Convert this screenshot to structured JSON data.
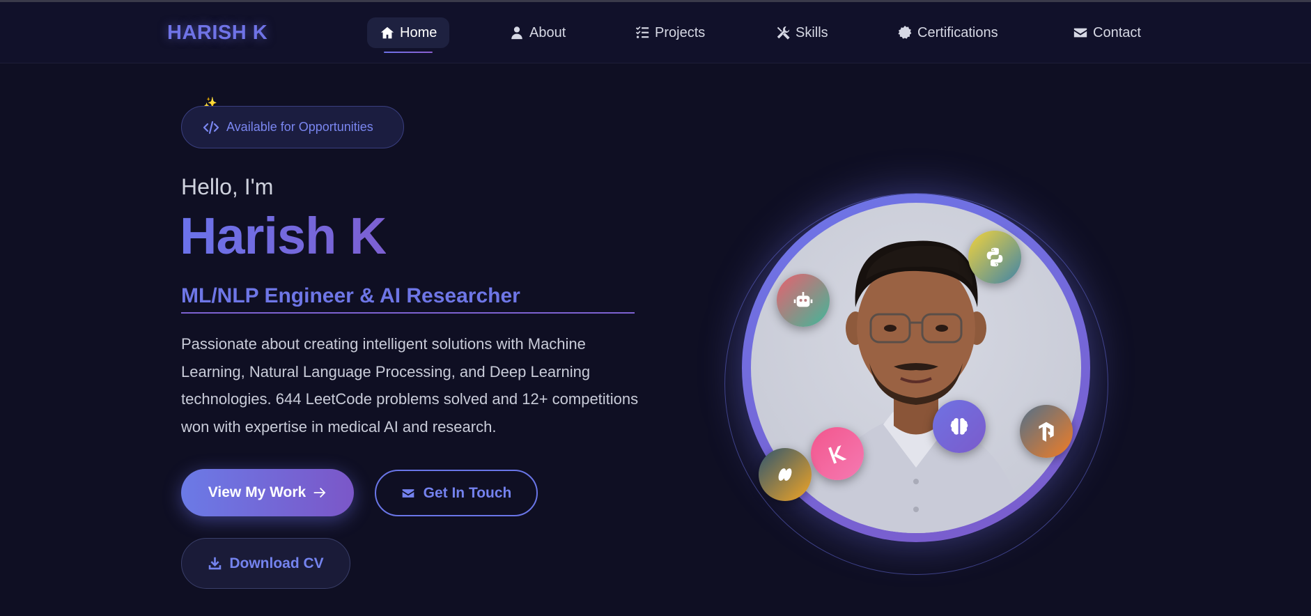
{
  "nav": {
    "logo": "HARISH K",
    "items": [
      {
        "label": "Home",
        "icon": "home-icon",
        "active": true
      },
      {
        "label": "About",
        "icon": "user-icon",
        "active": false
      },
      {
        "label": "Projects",
        "icon": "list-check-icon",
        "active": false
      },
      {
        "label": "Skills",
        "icon": "tools-icon",
        "active": false
      },
      {
        "label": "Certifications",
        "icon": "certificate-icon",
        "active": false
      },
      {
        "label": "Contact",
        "icon": "envelope-icon",
        "active": false
      }
    ]
  },
  "hero": {
    "badge": "Available for Opportunities",
    "greeting": "Hello, I'm",
    "name": "Harish K",
    "role": "ML/NLP Engineer & AI Researcher",
    "description": "Passionate about creating intelligent solutions with Machine Learning, Natural Language Processing, and Deep Learning technologies. 644 LeetCode problems solved and 12+ competitions won with expertise in medical AI and research.",
    "buttons": {
      "primary": "View My Work",
      "secondary": "Get In Touch",
      "download": "Download CV"
    }
  },
  "floating_icons": [
    "robot-icon",
    "python-icon",
    "brain-icon",
    "tensorflow-icon",
    "kaggle-icon",
    "database-icon"
  ],
  "colors": {
    "background": "#0f0f23",
    "accent": "#6e76e8",
    "accent2": "#7b5bcb"
  }
}
